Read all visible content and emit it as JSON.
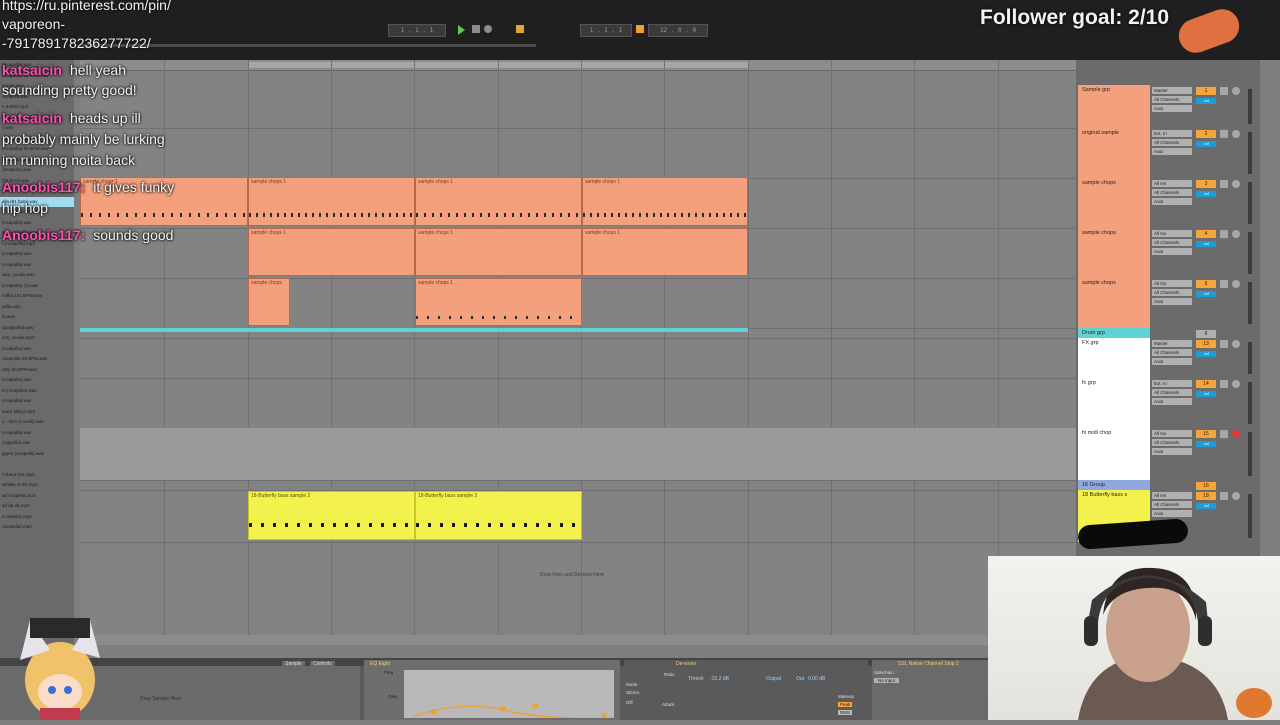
{
  "overlay": {
    "url_lines": [
      "https://ru.pinterest.com/pin/",
      "vaporeon-",
      "-791789178236277722/"
    ],
    "follower_goal": "Follower goal: 2/10"
  },
  "chat": [
    {
      "user": "katsaicin",
      "message": "hell yeah"
    },
    {
      "user": "",
      "message": "sounding pretty good!"
    },
    {
      "user": "katsaicin",
      "message": "heads up ill"
    },
    {
      "user": "",
      "message": "probably mainly be lurking"
    },
    {
      "user": "",
      "message": "im running noita back"
    },
    {
      "user": "Anoobis117:",
      "message": "it gives funky"
    },
    {
      "user": "",
      "message": "hip hop"
    },
    {
      "user": "Anoobis117:",
      "message": "sounds good"
    }
  ],
  "colors": {
    "orange_clip": "#f5a07d",
    "yellow_clip": "#f3f24c",
    "cyan_group": "#5fd3d3",
    "chat_user": "#ff4fb0"
  },
  "transport": {
    "tempo": "1 . 1 . 1",
    "position": "1 . 1 . 1",
    "loop": "1 . 1 . 1",
    "length": "12 . 0 . 0"
  },
  "tracks": [
    {
      "name": "Sample grp",
      "input": "Master",
      "number": "1",
      "color": "#f5a07d"
    },
    {
      "name": "original sample",
      "input": "Ext. In",
      "number": "2",
      "color": "#f5a07d"
    },
    {
      "name": "sample chops",
      "input": "All Ins",
      "number": "3",
      "color": "#f5a07d"
    },
    {
      "name": "sample chops",
      "input": "All Ins",
      "number": "4",
      "color": "#f5a07d"
    },
    {
      "name": "sample chops",
      "input": "All Ins",
      "number": "5",
      "color": "#f5a07d"
    },
    {
      "name": "Drum grp",
      "input": "",
      "number": "6",
      "color": "#5fd3d3"
    },
    {
      "name": "FX grp",
      "input": "Master",
      "number": "13",
      "color": "#ffffff"
    },
    {
      "name": "fx grp",
      "input": "Ext. In",
      "number": "14",
      "color": "#ffffff"
    },
    {
      "name": "fx midi chop",
      "input": "All Ins",
      "number": "15",
      "color": "#ffffff"
    },
    {
      "name": "16 Group",
      "input": "",
      "number": "16",
      "color": "#8fa8e0"
    },
    {
      "name": "18 Butterfly bass s",
      "input": "All Ins",
      "number": "18",
      "color": "#f3f24c"
    }
  ],
  "clips": {
    "chops_top": [
      "sample chops 1",
      "sample chops 1",
      "sample chops 1",
      "sample chops 1"
    ],
    "chops_mid": [
      "sample chops 1",
      "sample chops 1",
      "sample chops 1"
    ],
    "chops_low": [
      "sample chops",
      "sample chops 1"
    ],
    "bass": [
      "18-Butterfly bass sample 2",
      "18-Butterfly bass sample 2"
    ]
  },
  "mixer_labels": {
    "in": "In",
    "auto": "Auto",
    "off": "Off",
    "inf": "-inf",
    "all_channels": "All Channels",
    "no_input": "No Input",
    "sample_grp_route": "Sample grp"
  },
  "drop_text": "Drop Files and Devices Here",
  "browser_items": [
    "(Acapella).wav",
    "(Acapella) 90 BPM.wav",
    "vocals.wav",
    "Acapella.wav",
    "n-440hz.mp3",
    "(Acapella).wav",
    "s.wav",
    "ep Cry (vocals).wav",
    "(Acapella) 90 BPM.wav",
    "(Acapella).wav",
    "(acapella).wav",
    "(70 bpm).wav",
    "s.wav",
    "ella (81 bpm).wav",
    "Sweet (vocals).wav",
    "(Acapella).wav",
    "dio Acapella).wav",
    "t (Acapella).mp3",
    "(Acapella).wav",
    "(Acapella).wav",
    "aisu_vocals.wav",
    "(Acapella) (1).wav",
    "nella) 101 BPM.wav",
    "pella.wav",
    "s).wav",
    "(acappella).wav",
    "ami_vocals.mp3",
    "(Acapella).wav",
    "Acapella) 92 BPM.wav",
    "ella) 80 BPM.wav",
    "(Acapella).wav",
    "m (Acapella).wav",
    "(Acapella).wav",
    "ature (dirty).mp3",
    "1 - Intro (vocals).wav",
    "(Acapella).wav",
    "Cappella).wav",
    "ggers (Acapella).wav",
    "",
    "t About Dre.mp3",
    "whistle & rbs.mp3",
    "ad Acapella.mp3",
    "ad da da.mp3",
    "a capella).mp3",
    "(acapella).mp3"
  ],
  "devices": {
    "sample_tab": "Sample",
    "controls_tab": "Controls",
    "drop_sample": "Drop Sample Here",
    "eq": "EQ Eight",
    "deesser": "De-esser",
    "thresh": "Thresh",
    "thresh_val": "-15.2 dB",
    "output": "Output",
    "out": "Out",
    "out_val": "0.00 dB",
    "ssl": "SSL Native Channel Strip 2",
    "freq": "Freq",
    "gain": "Gain",
    "mode": "Mode",
    "stereo": "Stereo",
    "diff": "Diff",
    "ratio": "Ratio",
    "attack": "Attack",
    "makeup": "Makeup",
    "sidechain": "Sidechain",
    "no_input": "No Input",
    "peak": "Peak",
    "rms": "RMS",
    "sens": "Sens"
  }
}
